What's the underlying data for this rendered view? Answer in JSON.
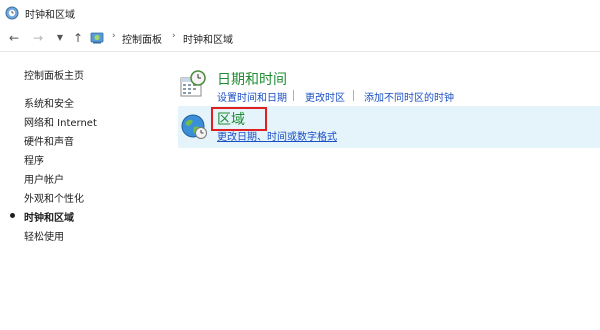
{
  "window": {
    "title": "时钟和区域"
  },
  "address_bar": {
    "breadcrumbs": [
      "控制面板",
      "时钟和区域"
    ]
  },
  "sidebar": {
    "home": "控制面板主页",
    "items": [
      {
        "label": "系统和安全",
        "active": false
      },
      {
        "label": "网络和 Internet",
        "active": false
      },
      {
        "label": "硬件和声音",
        "active": false
      },
      {
        "label": "程序",
        "active": false
      },
      {
        "label": "用户帐户",
        "active": false
      },
      {
        "label": "外观和个性化",
        "active": false
      },
      {
        "label": "时钟和区域",
        "active": true
      },
      {
        "label": "轻松使用",
        "active": false
      }
    ]
  },
  "main": {
    "date_time": {
      "title": "日期和时间",
      "icon": "calendar-clock-icon",
      "links": [
        "设置时间和日期",
        "更改时区",
        "添加不同时区的时钟"
      ]
    },
    "region": {
      "title": "区域",
      "icon": "globe-clock-icon",
      "links": [
        "更改日期、时间或数字格式"
      ]
    }
  },
  "colors": {
    "section_title": "#1e8c32",
    "link": "#1a4fc4",
    "selected_bg": "#e5f3fb",
    "highlight": "#e02020"
  }
}
